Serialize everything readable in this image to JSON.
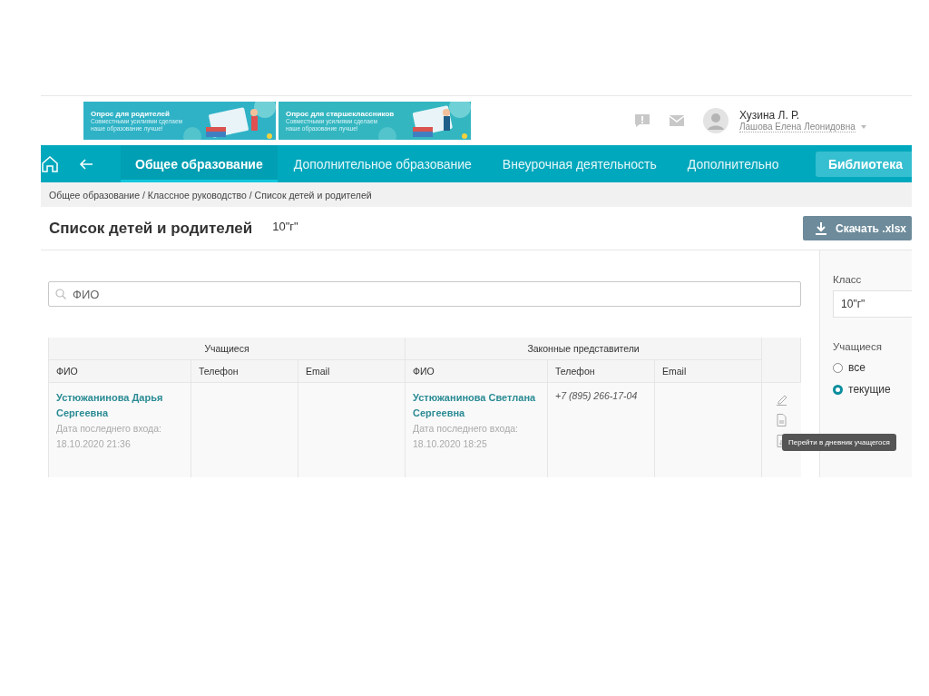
{
  "banners": [
    {
      "title": "Опрос для родителей",
      "text": "Совместными усилиями сделаем наше образование лучше!"
    },
    {
      "title": "Опрос для старшеклассников",
      "text": "Совместными усилиями сделаем наше образование лучше!"
    }
  ],
  "user": {
    "name": "Хузина Л. Р.",
    "role": "Лашова Елена Леонидовна"
  },
  "nav": {
    "tabs": [
      {
        "label": "Общее образование",
        "selected": true
      },
      {
        "label": "Дополнительное образование",
        "selected": false
      },
      {
        "label": "Внеурочная деятельность",
        "selected": false
      },
      {
        "label": "Дополнительно",
        "selected": false
      }
    ],
    "library": "Библиотека"
  },
  "breadcrumb": "Общее образование / Классное руководство / Список детей и родителей",
  "page": {
    "title": "Список детей и родителей",
    "class": "10\"г\"",
    "download": "Скачать .xlsx"
  },
  "search": {
    "placeholder": "ФИО"
  },
  "table": {
    "groups": [
      "Учащиеся",
      "Законные представители"
    ],
    "columns": [
      "ФИО",
      "Телефон",
      "Email",
      "ФИО",
      "Телефон",
      "Email"
    ],
    "rows": [
      {
        "student": {
          "name": "Устюжанинова Дарья Сергеевна",
          "last_login_label": "Дата последнего входа:",
          "last_login": "18.10.2020 21:36"
        },
        "parent": {
          "name": "Устюжанинова Светлана Сергеевна",
          "last_login_label": "Дата последнего входа:",
          "last_login": "18.10.2020 18:25",
          "phone": "+7 (895) 266-17-04"
        }
      }
    ]
  },
  "tooltip": "Перейти в дневник учащегося",
  "filters": {
    "class_label": "Класс",
    "class_value": "10\"г\"",
    "students_label": "Учащиеся",
    "options": [
      {
        "label": "все",
        "selected": false
      },
      {
        "label": "текущие",
        "selected": true
      }
    ]
  }
}
